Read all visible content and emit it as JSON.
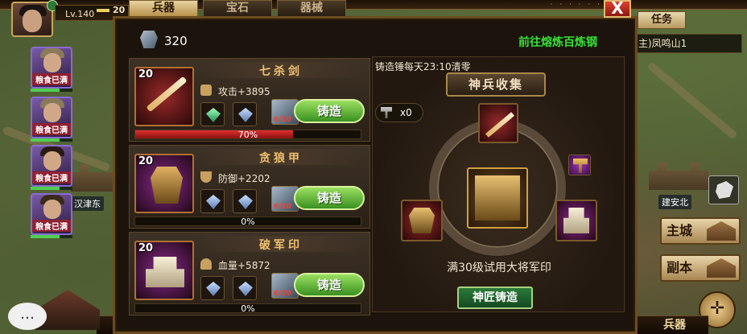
{
  "player": {
    "level": "Lv.140",
    "power": "20"
  },
  "heroes": [
    {
      "tag": "粮食已满"
    },
    {
      "tag": "粮食已满"
    },
    {
      "tag": "粮食已满"
    },
    {
      "tag": "粮食已满"
    }
  ],
  "map": {
    "label_left": "汉津东",
    "label_right": "建安北"
  },
  "quest": {
    "tab": "任务",
    "text": "主)凤鸣山1"
  },
  "city_buttons": {
    "main_city": "主城",
    "dungeon": "副本"
  },
  "bottom_bar": {
    "faded": "行",
    "weapon_tab": "兵器"
  },
  "chat_icon": "…",
  "compass_icon": "✛",
  "forge": {
    "close_label": "X",
    "tabs": [
      {
        "label": "兵器"
      },
      {
        "label": "宝石"
      },
      {
        "label": "器械"
      }
    ],
    "ore_count": "320",
    "refine_link": "前往熔炼百炼钢",
    "items": [
      {
        "level": "20",
        "name": "七杀剑",
        "stat": "攻击+3895",
        "ore_need": "6/10",
        "button": "铸造",
        "progress": 0.7,
        "progress_text": "70%"
      },
      {
        "level": "20",
        "name": "贪狼甲",
        "stat": "防御+2202",
        "ore_need": "6/10",
        "button": "铸造",
        "progress": 0.0,
        "progress_text": "0%"
      },
      {
        "level": "20",
        "name": "破军印",
        "stat": "血量+5872",
        "ore_need": "6/10",
        "button": "铸造",
        "progress": 0.0,
        "progress_text": "0%"
      }
    ],
    "collection": {
      "reset_note": "铸造锤每天23:10清零",
      "title": "神兵收集",
      "hammer_count": "x0",
      "description": "满30级试用大将军印",
      "button": "神匠铸造"
    }
  },
  "colors": {
    "accent_green": "#38e038",
    "progress_red": "#e03030",
    "close_red": "#e04030"
  }
}
